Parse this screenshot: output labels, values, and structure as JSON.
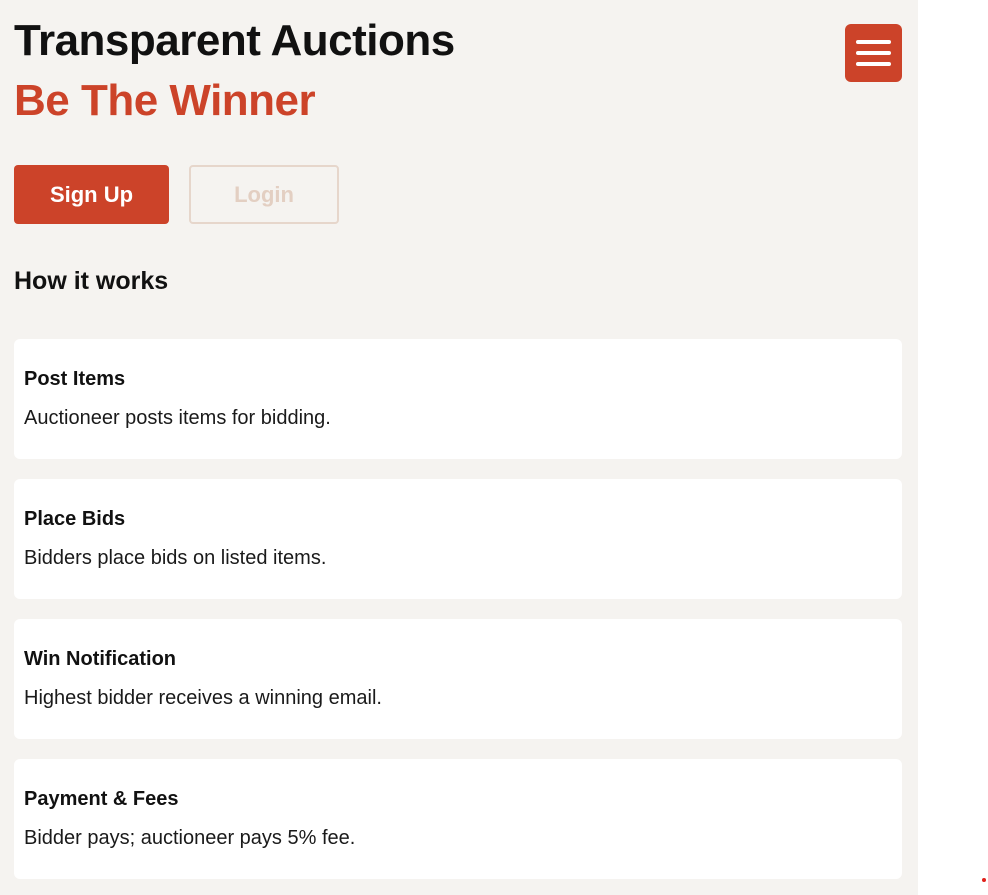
{
  "header": {
    "title": "Transparent Auctions",
    "tagline": "Be The Winner",
    "menu_icon": "hamburger-menu-icon"
  },
  "actions": {
    "signup_label": "Sign Up",
    "login_label": "Login"
  },
  "how_it_works": {
    "heading": "How it works",
    "steps": [
      {
        "title": "Post Items",
        "description": "Auctioneer posts items for bidding."
      },
      {
        "title": "Place Bids",
        "description": "Bidders place bids on listed items."
      },
      {
        "title": "Win Notification",
        "description": "Highest bidder receives a winning email."
      },
      {
        "title": "Payment & Fees",
        "description": "Bidder pays; auctioneer pays 5% fee."
      }
    ]
  },
  "colors": {
    "accent": "#cc4329",
    "background": "#f5f3f0",
    "card": "#ffffff",
    "text": "#111111"
  }
}
